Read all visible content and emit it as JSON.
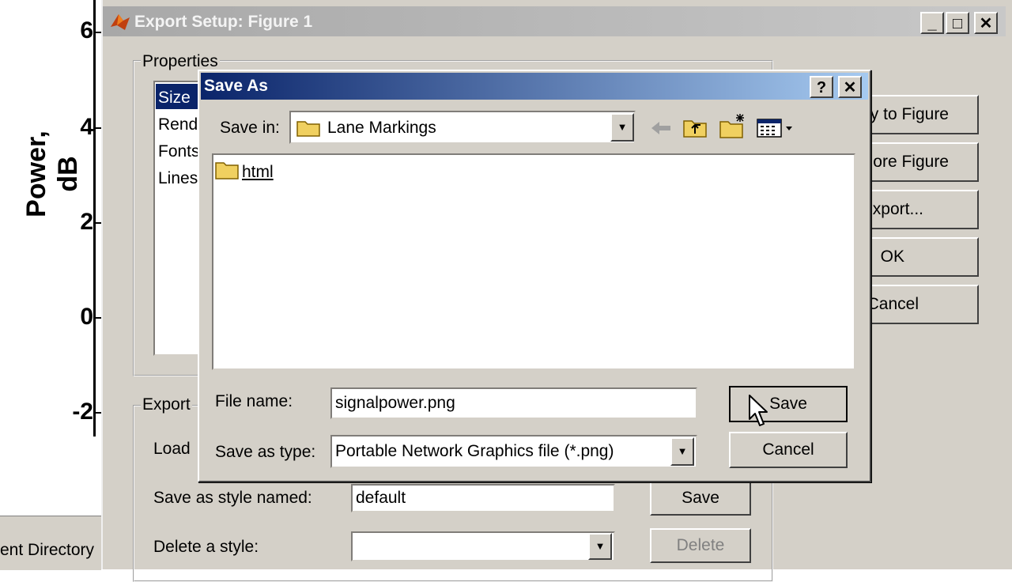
{
  "figure": {
    "ylabel": "Power, dB",
    "ticks": [
      "6",
      "4",
      "2",
      "0",
      "-2"
    ],
    "current_directory": "ent Directory"
  },
  "export_setup": {
    "title": "Export Setup: Figure 1",
    "properties_label": "Properties",
    "properties_items": [
      "Size",
      "Rend",
      "Fonts",
      "Lines"
    ],
    "right_buttons": [
      "y to Figure",
      "ore Figure",
      "xport...",
      "OK",
      "Cancel"
    ],
    "export_styles_label": "Export",
    "load_label": "Load",
    "save_style_label": "Save as style named:",
    "save_style_value": "default",
    "save_button": "Save",
    "delete_style_label": "Delete a style:",
    "delete_button": "Delete"
  },
  "save_as": {
    "title": "Save As",
    "help_button": "?",
    "close_button": "✕",
    "save_in_label": "Save in:",
    "save_in_value": "Lane Markings",
    "files": [
      {
        "name": "html"
      }
    ],
    "file_name_label": "File name:",
    "file_name_value": "signalpower.png",
    "save_type_label": "Save as type:",
    "save_type_value": "Portable Network Graphics file (*.png)",
    "save_button": "Save",
    "cancel_button": "Cancel"
  },
  "colors": {
    "dialog_face": "#d4d0c8",
    "active_title_start": "#0a246a",
    "active_title_end": "#a6caf0",
    "folder_yellow": "#f0d060"
  }
}
